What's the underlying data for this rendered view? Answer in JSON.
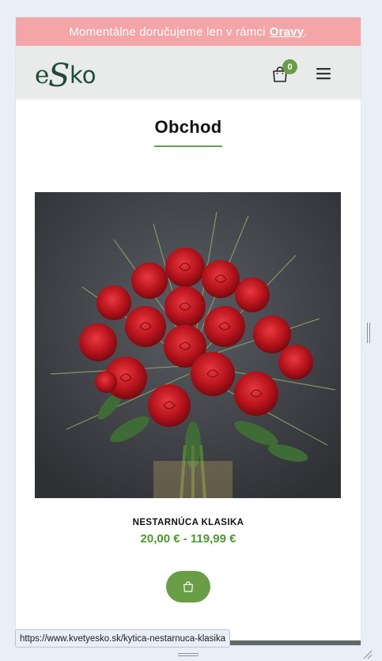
{
  "promo": {
    "text": "Momentálne doručujeme len v rámci",
    "link": "Oravy",
    "suffix": "."
  },
  "header": {
    "logo_alt": "eSko",
    "cart_count": "0"
  },
  "page": {
    "title": "Obchod"
  },
  "product": {
    "name": "NESTARNÚCA KLASIKA",
    "price": "20,00 € - 119,99 €",
    "image_desc": "red-roses-bouquet"
  },
  "status_bar": {
    "url": "https://www.kvetyesko.sk/kytica-nestarnuca-klasika"
  },
  "colors": {
    "promo_bg": "#f4a5a8",
    "header_bg": "#e8ebe9",
    "accent_green": "#6a9e46",
    "price_green": "#4a9a2c",
    "logo_dark_green": "#1f4a38"
  }
}
